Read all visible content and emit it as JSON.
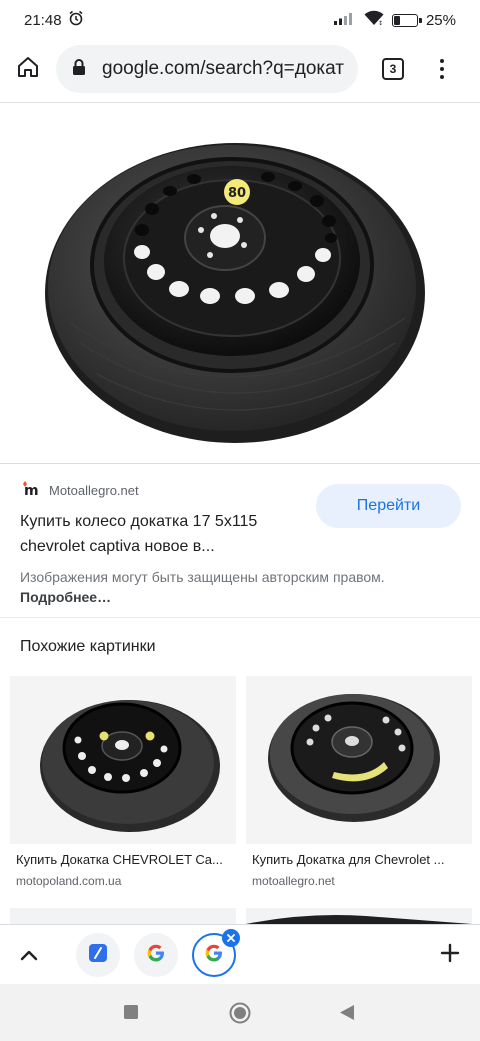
{
  "status_bar": {
    "time": "21:48",
    "battery": "25%",
    "battery_level": 0.25
  },
  "toolbar": {
    "url": "google.com/search?q=докат",
    "tab_count": "3"
  },
  "result": {
    "source_name": "Motoallegro.net",
    "go_button": "Перейти",
    "title": "Купить колесо докатка 17 5x115 chevrolet captiva новое в...",
    "notice": "Изображения могут быть защищены авторским правом.",
    "more_link": "Подробнее…"
  },
  "similar": {
    "heading": "Похожие картинки",
    "items": [
      {
        "caption": "Купить Докатка CHEVROLET Ca...",
        "site": "motopoland.com.ua"
      },
      {
        "caption": "Купить Докатка для Chevrolet ...",
        "site": "motoallegro.net"
      }
    ]
  },
  "icons": {
    "home": "home-icon",
    "lock": "lock-icon",
    "menu": "more-vert-icon",
    "chevron": "chevron-up-icon",
    "plus": "plus-icon"
  },
  "colors": {
    "accent": "#1a73e8",
    "button_bg": "#e8f0fe",
    "brand_orange": "#e8551f"
  }
}
